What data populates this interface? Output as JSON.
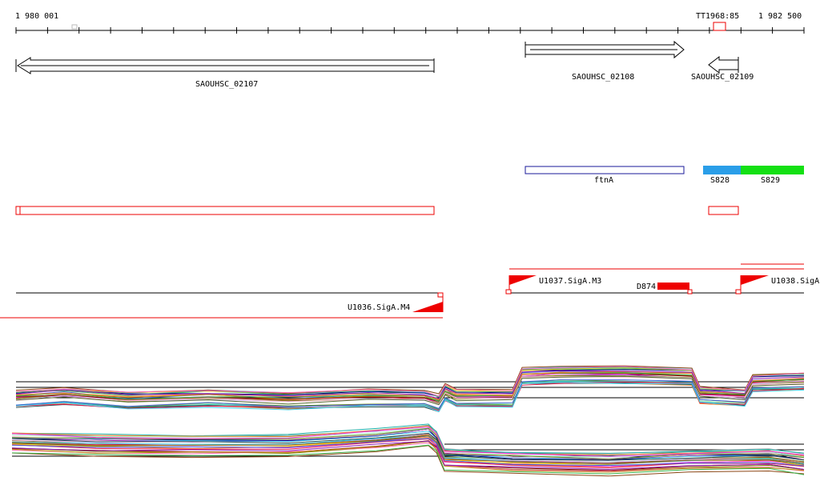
{
  "ruler": {
    "start_label": "1 980 001",
    "end_label": "1 982 500",
    "marker_label": "TT1968:85"
  },
  "genes": [
    {
      "id": "SAOUHSC_02107",
      "strand": "-"
    },
    {
      "id": "SAOUHSC_02108",
      "strand": "+"
    },
    {
      "id": "SAOUHSC_02109",
      "strand": "-"
    }
  ],
  "features": [
    {
      "label": "ftnA",
      "style": "outline",
      "color": "#1a1a9a"
    },
    {
      "label": "S828",
      "style": "filled",
      "color": "#2a9ee8"
    },
    {
      "label": "S829",
      "style": "filled",
      "color": "#13e013"
    }
  ],
  "segments": [
    {
      "label": "U1037.SigA.M3",
      "strand": "+"
    },
    {
      "label": "D874",
      "strand": "+"
    },
    {
      "label": "U1038.SigA",
      "strand": "+"
    },
    {
      "label": "U1036.SigA.M4",
      "strand": "-"
    }
  ],
  "colors": {
    "red": "#ee0000",
    "outline": "#000000",
    "axis": "#000000"
  }
}
